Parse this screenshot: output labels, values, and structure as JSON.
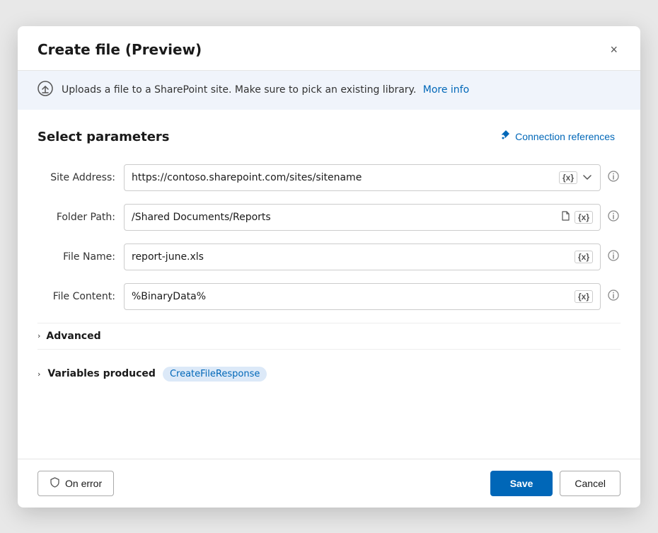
{
  "dialog": {
    "title": "Create file (Preview)",
    "close_label": "×"
  },
  "banner": {
    "text": "Uploads a file to a SharePoint site. Make sure to pick an existing library.",
    "link_text": "More info",
    "icon": "📤"
  },
  "section": {
    "title": "Select parameters",
    "connection_ref_label": "Connection references"
  },
  "fields": [
    {
      "label": "Site Address:",
      "value": "https://contoso.sharepoint.com/sites/sitename",
      "has_dropdown": true,
      "has_curly": true,
      "has_file_icon": false,
      "info": true
    },
    {
      "label": "Folder Path:",
      "value": "/Shared Documents/Reports",
      "has_dropdown": false,
      "has_curly": true,
      "has_file_icon": true,
      "info": true
    },
    {
      "label": "File Name:",
      "value": "report-june.xls",
      "has_dropdown": false,
      "has_curly": true,
      "has_file_icon": false,
      "info": true
    },
    {
      "label": "File Content:",
      "value": "%BinaryData%",
      "has_dropdown": false,
      "has_curly": true,
      "has_file_icon": false,
      "info": true
    }
  ],
  "advanced": {
    "label": "Advanced",
    "chevron": "›"
  },
  "variables": {
    "label": "Variables produced",
    "chevron": "›",
    "badge": "CreateFileResponse"
  },
  "footer": {
    "on_error_label": "On error",
    "save_label": "Save",
    "cancel_label": "Cancel"
  },
  "icons": {
    "curly": "{x}",
    "dropdown": "∨",
    "info": "ⓘ",
    "close": "✕",
    "plug": "🔌",
    "shield": "🛡",
    "file": "🗋"
  },
  "colors": {
    "accent": "#0067b8",
    "banner_bg": "#f0f4fb"
  }
}
